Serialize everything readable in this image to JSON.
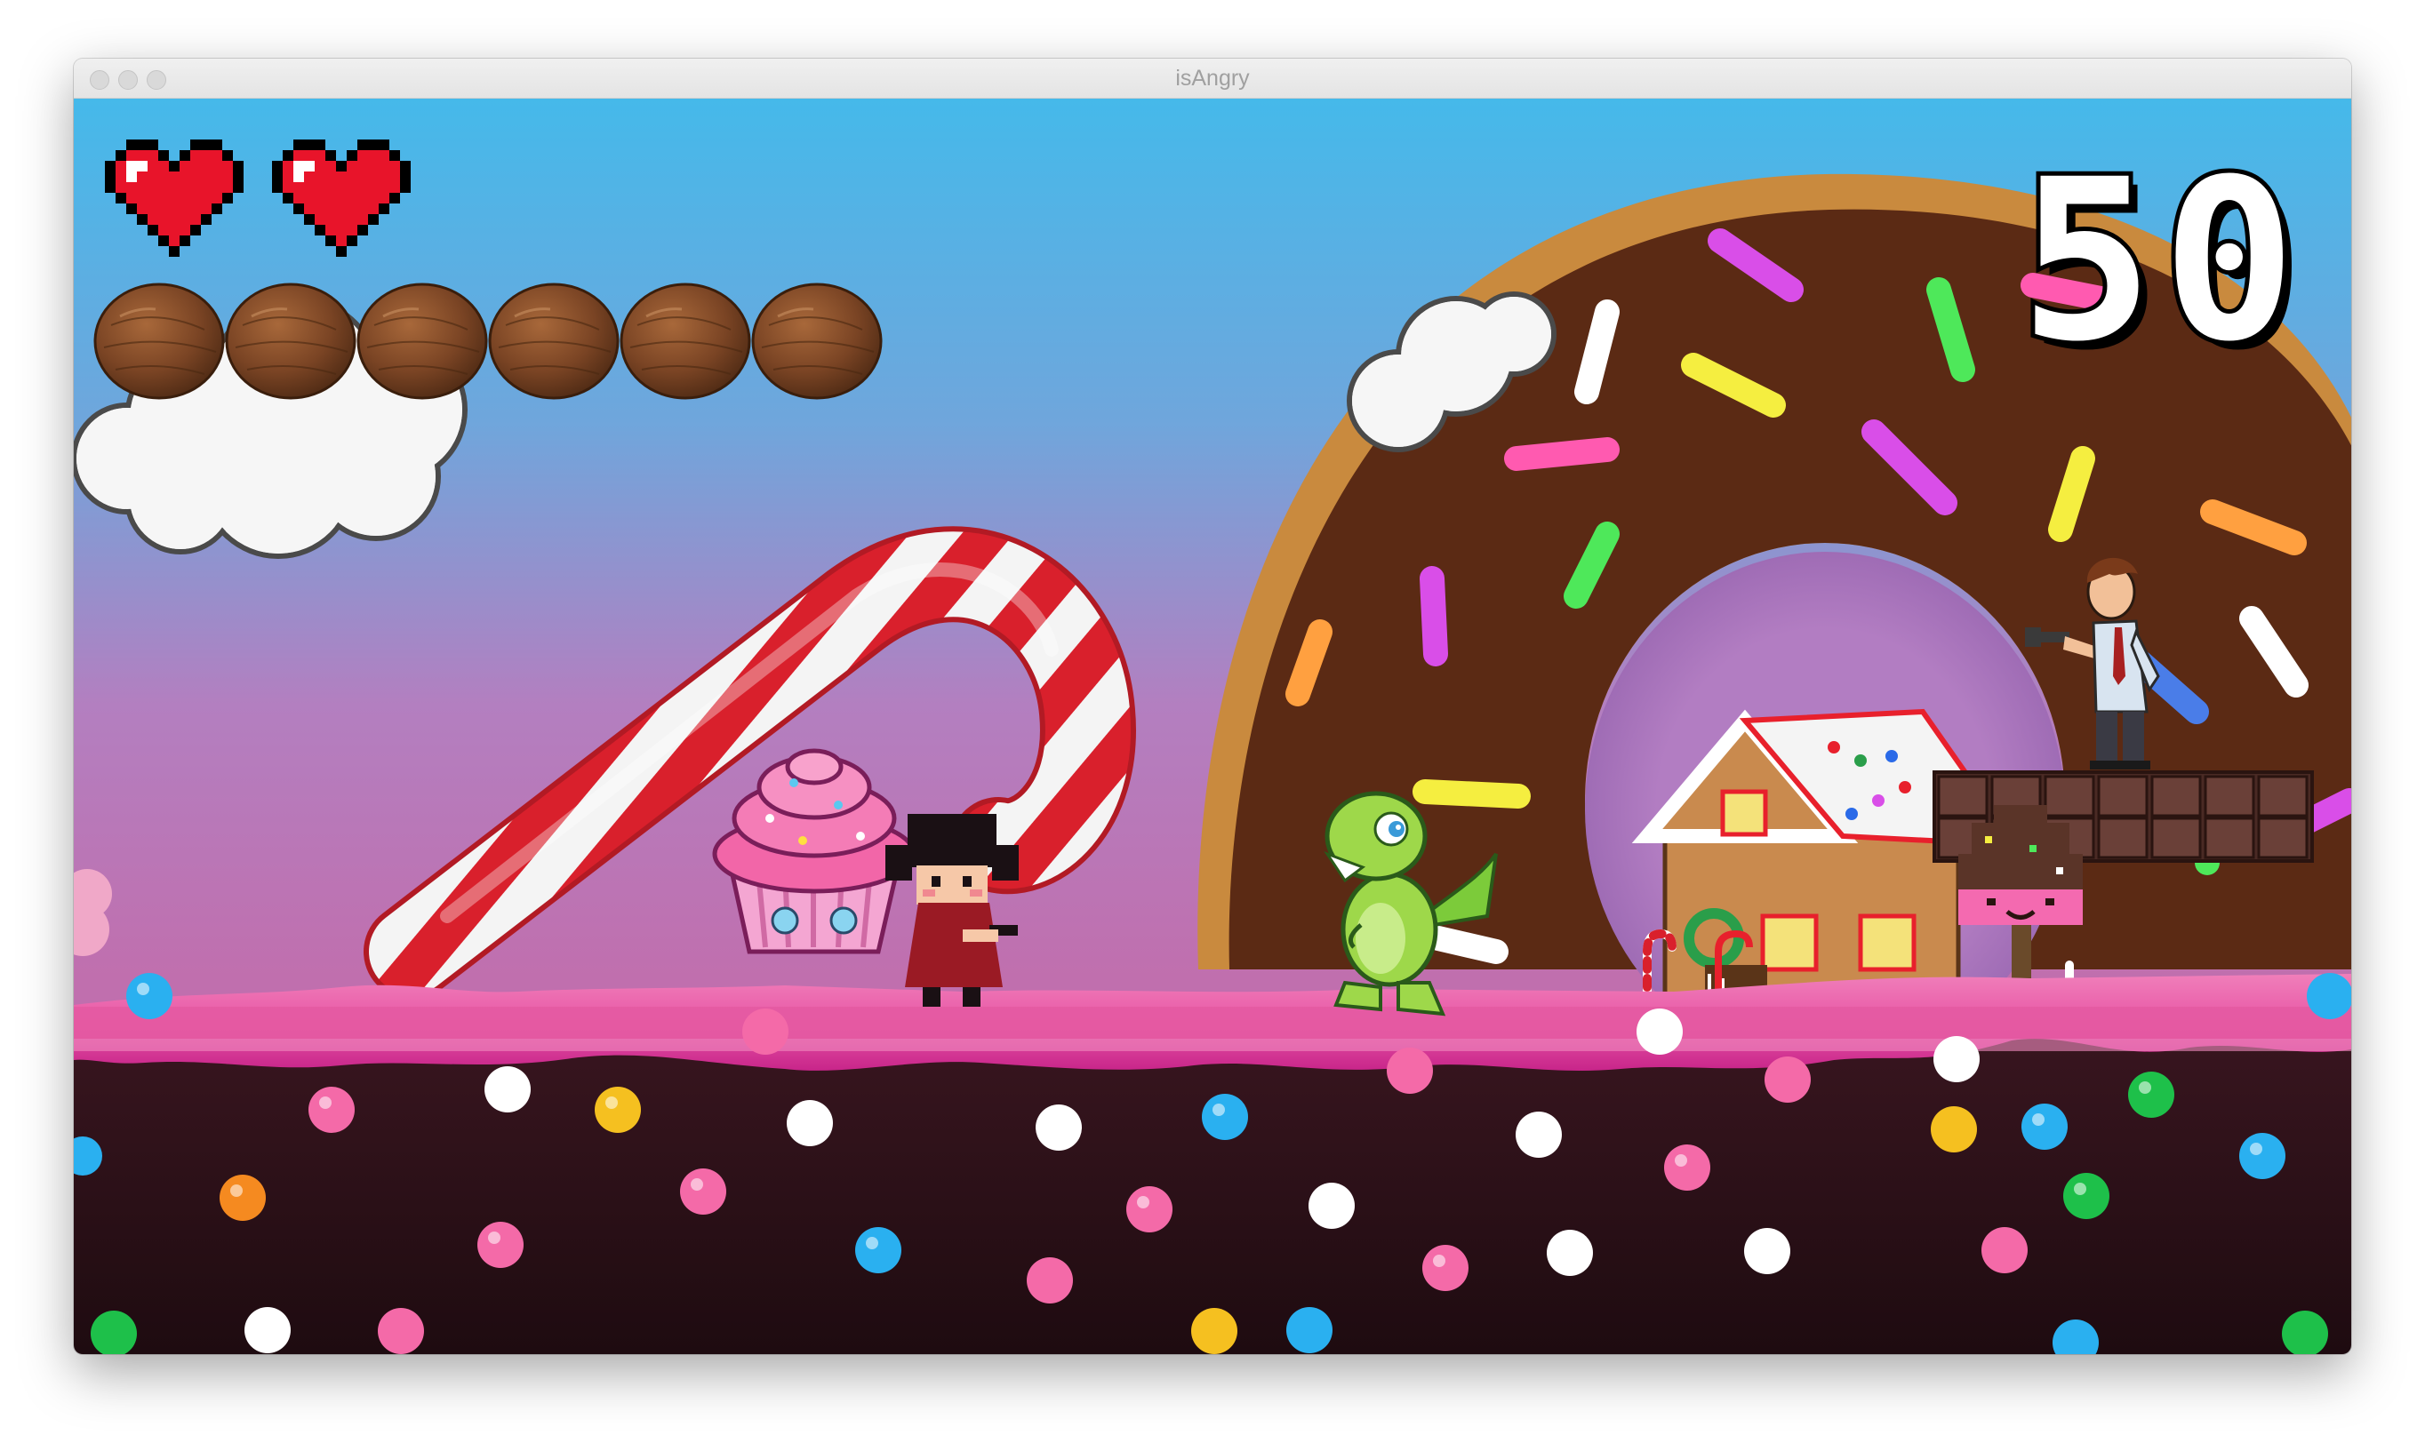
{
  "window": {
    "title": "isAngry"
  },
  "hud": {
    "lives": 2,
    "coconut_ammo": 6,
    "score": "50"
  },
  "icons": {
    "life": "pixel-heart-icon",
    "ammo": "coconut-icon"
  },
  "colors": {
    "sky_top": "#47b8e8",
    "sky_bottom": "#c878b8",
    "frosting": "#ec5fa8",
    "ground": "#2a1016",
    "donut_dough": "#c98a3e",
    "donut_chocolate": "#5b2a14",
    "heart": "#e8142a",
    "candy_cane_red": "#d9202c"
  }
}
